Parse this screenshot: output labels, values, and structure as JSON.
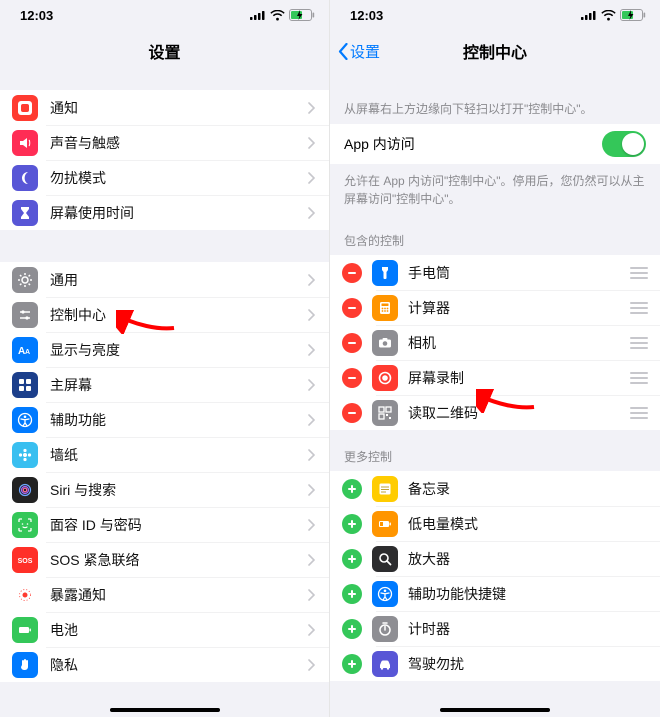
{
  "statusbar": {
    "time": "12:03"
  },
  "left": {
    "title": "设置",
    "groups": [
      {
        "items": [
          {
            "key": "notifications",
            "label": "通知",
            "iconColor": "#ff3b30",
            "iconName": "bell-square-icon"
          },
          {
            "key": "sounds",
            "label": "声音与触感",
            "iconColor": "#ff2d55",
            "iconName": "speaker-icon"
          },
          {
            "key": "dnd",
            "label": "勿扰模式",
            "iconColor": "#5856d6",
            "iconName": "moon-icon"
          },
          {
            "key": "screentime",
            "label": "屏幕使用时间",
            "iconColor": "#5856d6",
            "iconName": "hourglass-icon"
          }
        ]
      },
      {
        "items": [
          {
            "key": "general",
            "label": "通用",
            "iconColor": "#8e8e93",
            "iconName": "gear-icon"
          },
          {
            "key": "controlcenter",
            "label": "控制中心",
            "iconColor": "#8e8e93",
            "iconName": "sliders-icon"
          },
          {
            "key": "display",
            "label": "显示与亮度",
            "iconColor": "#007aff",
            "iconName": "text-size-icon"
          },
          {
            "key": "homescreen",
            "label": "主屏幕",
            "iconColor": "#1c3f8b",
            "iconName": "grid-icon"
          },
          {
            "key": "accessibility",
            "label": "辅助功能",
            "iconColor": "#007aff",
            "iconName": "accessibility-icon"
          },
          {
            "key": "wallpaper",
            "label": "墙纸",
            "iconColor": "#39bff0",
            "iconName": "flower-icon"
          },
          {
            "key": "siri",
            "label": "Siri 与搜索",
            "iconColor": "#222",
            "iconName": "siri-icon"
          },
          {
            "key": "faceid",
            "label": "面容 ID 与密码",
            "iconColor": "#34c759",
            "iconName": "faceid-icon"
          },
          {
            "key": "sos",
            "label": "SOS 紧急联络",
            "iconColor": "#ff3028",
            "iconName": "sos-icon"
          },
          {
            "key": "exposure",
            "label": "暴露通知",
            "iconColor": "#ffffff",
            "iconName": "exposure-icon"
          },
          {
            "key": "battery",
            "label": "电池",
            "iconColor": "#34c759",
            "iconName": "battery-icon"
          },
          {
            "key": "privacy",
            "label": "隐私",
            "iconColor": "#007aff",
            "iconName": "hand-icon"
          }
        ]
      }
    ]
  },
  "right": {
    "back": "设置",
    "title": "控制中心",
    "intro": "从屏幕右上方边缘向下轻扫以打开\"控制中心\"。",
    "appAccess": {
      "label": "App 内访问",
      "on": true
    },
    "appAccessFooter": "允许在 App 内访问\"控制中心\"。停用后，您仍然可以从主屏幕访问\"控制中心\"。",
    "includedHeader": "包含的控制",
    "included": [
      {
        "key": "flashlight",
        "label": "手电筒",
        "iconColor": "#007aff",
        "iconName": "flashlight-icon"
      },
      {
        "key": "calculator",
        "label": "计算器",
        "iconColor": "#ff9500",
        "iconName": "calculator-icon"
      },
      {
        "key": "camera",
        "label": "相机",
        "iconColor": "#8e8e93",
        "iconName": "camera-icon"
      },
      {
        "key": "screenrecord",
        "label": "屏幕录制",
        "iconColor": "#ff3b30",
        "iconName": "record-icon"
      },
      {
        "key": "qrcode",
        "label": "读取二维码",
        "iconColor": "#8e8e93",
        "iconName": "qrcode-icon"
      }
    ],
    "moreHeader": "更多控制",
    "more": [
      {
        "key": "notes",
        "label": "备忘录",
        "iconColor": "#ffcc00",
        "iconName": "notes-icon"
      },
      {
        "key": "lowpower",
        "label": "低电量模式",
        "iconColor": "#ff9500",
        "iconName": "lowpower-icon"
      },
      {
        "key": "magnifier",
        "label": "放大器",
        "iconColor": "#2c2c2e",
        "iconName": "magnifier-icon"
      },
      {
        "key": "a11yshortcut",
        "label": "辅助功能快捷键",
        "iconColor": "#007aff",
        "iconName": "accessibility-icon"
      },
      {
        "key": "timer",
        "label": "计时器",
        "iconColor": "#8e8e93",
        "iconName": "timer-icon"
      },
      {
        "key": "drivingdnd",
        "label": "驾驶勿扰",
        "iconColor": "#5856d6",
        "iconName": "car-icon"
      }
    ]
  },
  "arrows": [
    {
      "target": "控制中心"
    },
    {
      "target": "屏幕录制"
    }
  ]
}
